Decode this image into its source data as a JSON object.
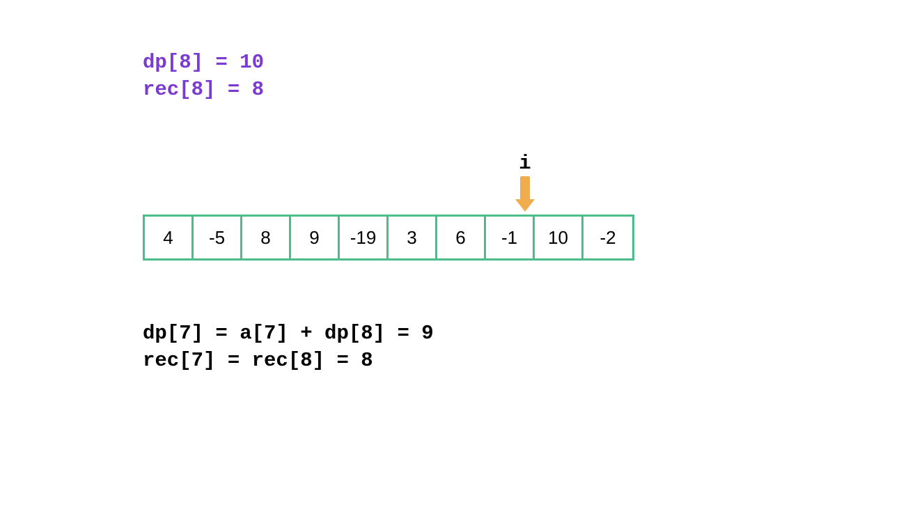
{
  "topText": {
    "line1": "dp[8] = 10",
    "line2": "rec[8] = 8"
  },
  "pointer": {
    "label": "i",
    "index": 7
  },
  "array": {
    "values": [
      "4",
      "-5",
      "8",
      "9",
      "-19",
      "3",
      "6",
      "-1",
      "10",
      "-2"
    ]
  },
  "bottomText": {
    "line1": "dp[7] = a[7] + dp[8] = 9",
    "line2": "rec[7] = rec[8] = 8"
  },
  "layout": {
    "cellWidth": 70,
    "borderWidth": 3
  }
}
